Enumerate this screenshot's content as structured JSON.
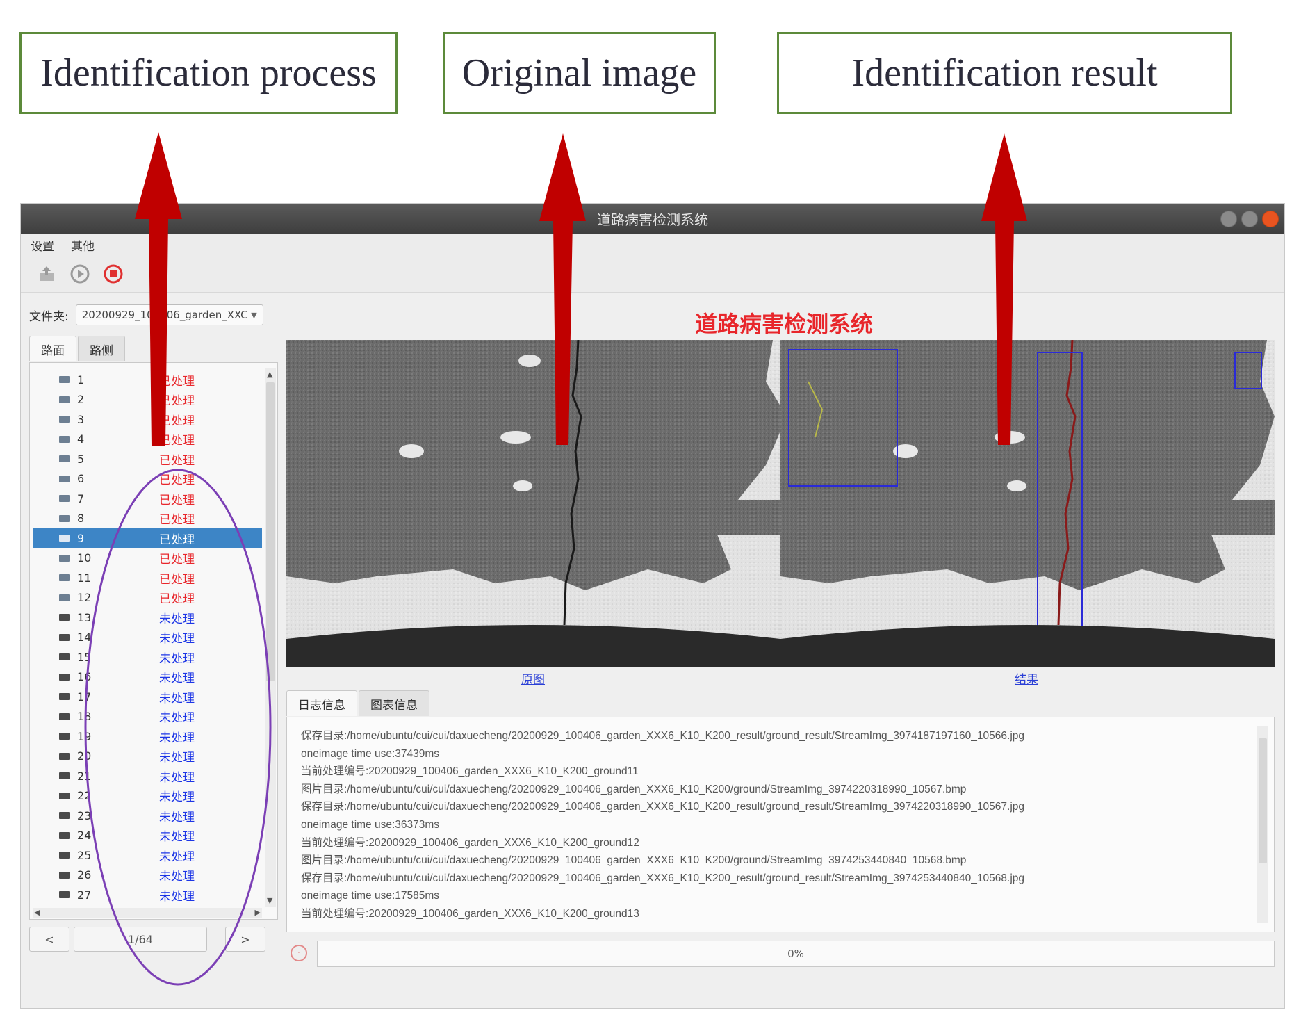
{
  "annotations": {
    "process_label": "Identification process",
    "original_label": "Original image",
    "result_label": "Identification result"
  },
  "window": {
    "title": "道路病害检测系统",
    "menu": [
      "设置",
      "其他"
    ],
    "toolbar_icons": [
      "export-icon",
      "play-icon",
      "stop-icon"
    ]
  },
  "folder": {
    "label": "文件夹:",
    "selected": "20200929_100406_garden_XXC"
  },
  "heading": "道路病害检测系统",
  "left_tabs": [
    "路面",
    "路侧"
  ],
  "items": [
    {
      "num": "1",
      "status": "已处理",
      "state": "done"
    },
    {
      "num": "2",
      "status": "已处理",
      "state": "done"
    },
    {
      "num": "3",
      "status": "已处理",
      "state": "done"
    },
    {
      "num": "4",
      "status": "已处理",
      "state": "done"
    },
    {
      "num": "5",
      "status": "已处理",
      "state": "done"
    },
    {
      "num": "6",
      "status": "已处理",
      "state": "done"
    },
    {
      "num": "7",
      "status": "已处理",
      "state": "done"
    },
    {
      "num": "8",
      "status": "已处理",
      "state": "done"
    },
    {
      "num": "9",
      "status": "已处理",
      "state": "done",
      "selected": true
    },
    {
      "num": "10",
      "status": "已处理",
      "state": "done"
    },
    {
      "num": "11",
      "status": "已处理",
      "state": "done"
    },
    {
      "num": "12",
      "status": "已处理",
      "state": "done"
    },
    {
      "num": "13",
      "status": "未处理",
      "state": "pending"
    },
    {
      "num": "14",
      "status": "未处理",
      "state": "pending"
    },
    {
      "num": "15",
      "status": "未处理",
      "state": "pending"
    },
    {
      "num": "16",
      "status": "未处理",
      "state": "pending"
    },
    {
      "num": "17",
      "status": "未处理",
      "state": "pending"
    },
    {
      "num": "18",
      "status": "未处理",
      "state": "pending"
    },
    {
      "num": "19",
      "status": "未处理",
      "state": "pending"
    },
    {
      "num": "20",
      "status": "未处理",
      "state": "pending"
    },
    {
      "num": "21",
      "status": "未处理",
      "state": "pending"
    },
    {
      "num": "22",
      "status": "未处理",
      "state": "pending"
    },
    {
      "num": "23",
      "status": "未处理",
      "state": "pending"
    },
    {
      "num": "24",
      "status": "未处理",
      "state": "pending"
    },
    {
      "num": "25",
      "status": "未处理",
      "state": "pending"
    },
    {
      "num": "26",
      "status": "未处理",
      "state": "pending"
    },
    {
      "num": "27",
      "status": "未处理",
      "state": "pending"
    }
  ],
  "pager": {
    "prev": "<",
    "page": "1/64",
    "next": ">"
  },
  "captions": {
    "original": "原图",
    "result": "结果"
  },
  "log_tabs": [
    "日志信息",
    "图表信息"
  ],
  "log": [
    "保存目录:/home/ubuntu/cui/cui/daxuecheng/20200929_100406_garden_XXX6_K10_K200_result/ground_result/StreamImg_3974187197160_10566.jpg",
    "oneimage time use:37439ms",
    "当前处理编号:20200929_100406_garden_XXX6_K10_K200_ground11",
    "图片目录:/home/ubuntu/cui/cui/daxuecheng/20200929_100406_garden_XXX6_K10_K200/ground/StreamImg_3974220318990_10567.bmp",
    "保存目录:/home/ubuntu/cui/cui/daxuecheng/20200929_100406_garden_XXX6_K10_K200_result/ground_result/StreamImg_3974220318990_10567.jpg",
    "oneimage time use:36373ms",
    "当前处理编号:20200929_100406_garden_XXX6_K10_K200_ground12",
    "图片目录:/home/ubuntu/cui/cui/daxuecheng/20200929_100406_garden_XXX6_K10_K200/ground/StreamImg_3974253440840_10568.bmp",
    "保存目录:/home/ubuntu/cui/cui/daxuecheng/20200929_100406_garden_XXX6_K10_K200_result/ground_result/StreamImg_3974253440840_10568.jpg",
    "oneimage time use:17585ms",
    "当前处理编号:20200929_100406_garden_XXX6_K10_K200_ground13"
  ],
  "progress": "0%",
  "colors": {
    "annotation_border": "#5c8a3a",
    "arrow": "#c00000",
    "ellipse": "#7b3fb5",
    "processed": "#e8262b",
    "unprocessed": "#1c35e6",
    "selection": "#3d85c6",
    "heading": "#e8262b",
    "bbox": "#2a2ad8"
  }
}
